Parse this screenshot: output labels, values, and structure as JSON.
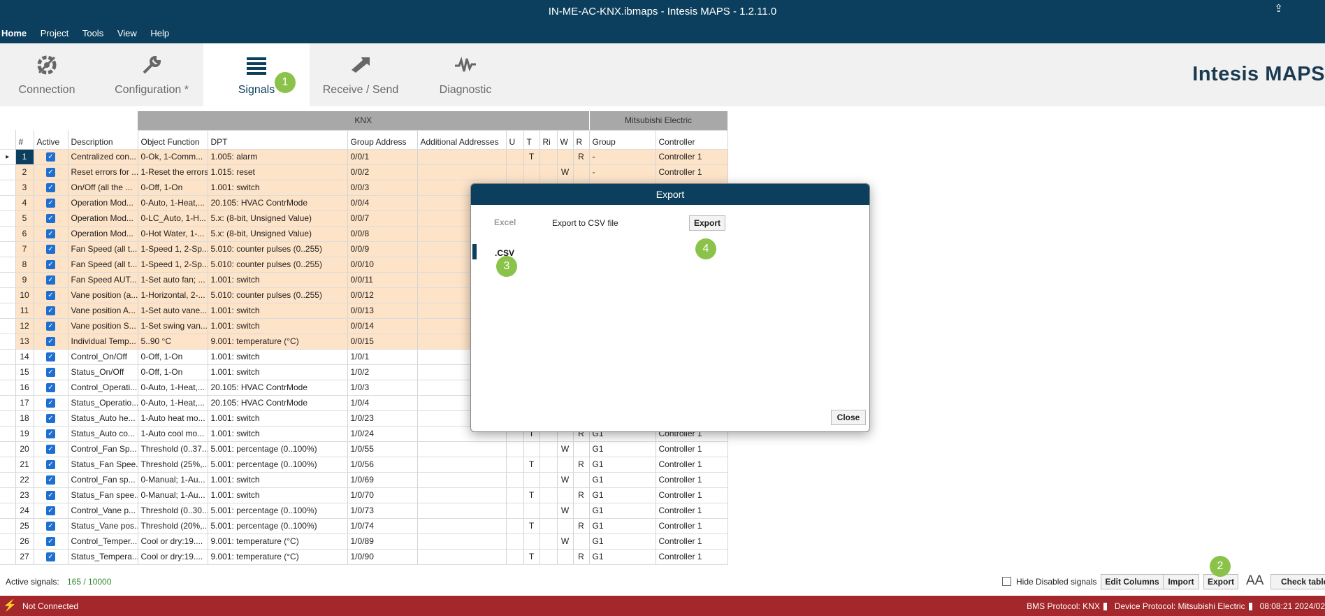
{
  "window": {
    "title": "IN-ME-AC-KNX.ibmaps - Intesis MAPS - 1.2.11.0"
  },
  "menu": {
    "items": [
      "Home",
      "Project",
      "Tools",
      "View",
      "Help"
    ]
  },
  "ribbon": {
    "tabs": [
      {
        "label": "Connection",
        "icon": "connection-gear-icon"
      },
      {
        "label": "Configuration *",
        "icon": "wrench-icon"
      },
      {
        "label": "Signals",
        "icon": "list-icon"
      },
      {
        "label": "Receive / Send",
        "icon": "send-arrows-icon"
      },
      {
        "label": "Diagnostic",
        "icon": "waveform-icon"
      }
    ],
    "active_tab": "Signals",
    "brand": "Intesis MAPS"
  },
  "badges": [
    "1",
    "2",
    "3",
    "4"
  ],
  "table": {
    "groups": {
      "knx": "KNX",
      "vendor": "Mitsubishi Electric"
    },
    "columns": [
      "#",
      "Active",
      "Description",
      "Object Function",
      "DPT",
      "Group Address",
      "Additional Addresses",
      "U",
      "T",
      "Ri",
      "W",
      "R",
      "Group",
      "Controller"
    ],
    "rows": [
      {
        "n": "1",
        "desc": "Centralized con...",
        "obj": "0-Ok, 1-Comm...",
        "dpt": "1.005: alarm",
        "ga": "0/0/1",
        "t": "T",
        "w": "",
        "r": "R",
        "grp": "-",
        "ctrl": "Controller 1"
      },
      {
        "n": "2",
        "desc": "Reset errors for ...",
        "obj": "1-Reset the errors",
        "dpt": "1.015: reset",
        "ga": "0/0/2",
        "t": "",
        "w": "W",
        "r": "",
        "grp": "-",
        "ctrl": "Controller 1"
      },
      {
        "n": "3",
        "desc": "On/Off (all the ...",
        "obj": "0-Off, 1-On",
        "dpt": "1.001: switch",
        "ga": "0/0/3",
        "t": "",
        "w": "",
        "r": "",
        "grp": "",
        "ctrl": ""
      },
      {
        "n": "4",
        "desc": "Operation Mod...",
        "obj": "0-Auto, 1-Heat,...",
        "dpt": "20.105: HVAC ContrMode",
        "ga": "0/0/4",
        "t": "",
        "w": "",
        "r": "",
        "grp": "",
        "ctrl": ""
      },
      {
        "n": "5",
        "desc": "Operation Mod...",
        "obj": "0-LC_Auto, 1-H...",
        "dpt": "5.x: (8-bit, Unsigned Value)",
        "ga": "0/0/7",
        "t": "",
        "w": "",
        "r": "",
        "grp": "",
        "ctrl": ""
      },
      {
        "n": "6",
        "desc": "Operation Mod...",
        "obj": "0-Hot Water, 1-...",
        "dpt": "5.x: (8-bit, Unsigned Value)",
        "ga": "0/0/8",
        "t": "",
        "w": "",
        "r": "",
        "grp": "",
        "ctrl": ""
      },
      {
        "n": "7",
        "desc": "Fan Speed (all t...",
        "obj": "1-Speed 1, 2-Sp...",
        "dpt": "5.010: counter pulses (0..255)",
        "ga": "0/0/9",
        "t": "",
        "w": "",
        "r": "",
        "grp": "",
        "ctrl": ""
      },
      {
        "n": "8",
        "desc": "Fan Speed (all t...",
        "obj": "1-Speed 1, 2-Sp...",
        "dpt": "5.010: counter pulses (0..255)",
        "ga": "0/0/10",
        "t": "",
        "w": "",
        "r": "",
        "grp": "",
        "ctrl": ""
      },
      {
        "n": "9",
        "desc": "Fan Speed AUT...",
        "obj": "1-Set auto fan; ...",
        "dpt": "1.001: switch",
        "ga": "0/0/11",
        "t": "",
        "w": "",
        "r": "",
        "grp": "",
        "ctrl": ""
      },
      {
        "n": "10",
        "desc": "Vane position (a...",
        "obj": "1-Horizontal, 2-...",
        "dpt": "5.010: counter pulses (0..255)",
        "ga": "0/0/12",
        "t": "",
        "w": "",
        "r": "",
        "grp": "",
        "ctrl": ""
      },
      {
        "n": "11",
        "desc": "Vane position A...",
        "obj": "1-Set auto vane...",
        "dpt": "1.001: switch",
        "ga": "0/0/13",
        "t": "",
        "w": "",
        "r": "",
        "grp": "",
        "ctrl": ""
      },
      {
        "n": "12",
        "desc": "Vane position S...",
        "obj": "1-Set swing van...",
        "dpt": "1.001: switch",
        "ga": "0/0/14",
        "t": "",
        "w": "",
        "r": "",
        "grp": "",
        "ctrl": ""
      },
      {
        "n": "13",
        "desc": "Individual Temp...",
        "obj": "5..90 °C",
        "dpt": "9.001: temperature (°C)",
        "ga": "0/0/15",
        "t": "",
        "w": "",
        "r": "",
        "grp": "",
        "ctrl": ""
      },
      {
        "n": "14",
        "desc": "Control_On/Off",
        "obj": "0-Off, 1-On",
        "dpt": "1.001: switch",
        "ga": "1/0/1",
        "t": "",
        "w": "",
        "r": "",
        "grp": "",
        "ctrl": ""
      },
      {
        "n": "15",
        "desc": "Status_On/Off",
        "obj": "0-Off, 1-On",
        "dpt": "1.001: switch",
        "ga": "1/0/2",
        "t": "",
        "w": "",
        "r": "",
        "grp": "",
        "ctrl": ""
      },
      {
        "n": "16",
        "desc": "Control_Operati...",
        "obj": "0-Auto, 1-Heat,...",
        "dpt": "20.105: HVAC ContrMode",
        "ga": "1/0/3",
        "t": "",
        "w": "",
        "r": "",
        "grp": "",
        "ctrl": ""
      },
      {
        "n": "17",
        "desc": "Status_Operatio...",
        "obj": "0-Auto, 1-Heat,...",
        "dpt": "20.105: HVAC ContrMode",
        "ga": "1/0/4",
        "t": "",
        "w": "",
        "r": "",
        "grp": "",
        "ctrl": ""
      },
      {
        "n": "18",
        "desc": "Status_Auto he...",
        "obj": "1-Auto heat mo...",
        "dpt": "1.001: switch",
        "ga": "1/0/23",
        "t": "",
        "w": "",
        "r": "",
        "grp": "",
        "ctrl": ""
      },
      {
        "n": "19",
        "desc": "Status_Auto co...",
        "obj": "1-Auto cool mo...",
        "dpt": "1.001: switch",
        "ga": "1/0/24",
        "t": "T",
        "w": "",
        "r": "R",
        "grp": "G1",
        "ctrl": "Controller 1"
      },
      {
        "n": "20",
        "desc": "Control_Fan Sp...",
        "obj": "Threshold (0..37...",
        "dpt": "5.001: percentage (0..100%)",
        "ga": "1/0/55",
        "t": "",
        "w": "W",
        "r": "",
        "grp": "G1",
        "ctrl": "Controller 1"
      },
      {
        "n": "21",
        "desc": "Status_Fan Spee...",
        "obj": "Threshold (25%,...",
        "dpt": "5.001: percentage (0..100%)",
        "ga": "1/0/56",
        "t": "T",
        "w": "",
        "r": "R",
        "grp": "G1",
        "ctrl": "Controller 1"
      },
      {
        "n": "22",
        "desc": "Control_Fan sp...",
        "obj": "0-Manual; 1-Au...",
        "dpt": "1.001: switch",
        "ga": "1/0/69",
        "t": "",
        "w": "W",
        "r": "",
        "grp": "G1",
        "ctrl": "Controller 1"
      },
      {
        "n": "23",
        "desc": "Status_Fan spee...",
        "obj": "0-Manual; 1-Au...",
        "dpt": "1.001: switch",
        "ga": "1/0/70",
        "t": "T",
        "w": "",
        "r": "R",
        "grp": "G1",
        "ctrl": "Controller 1"
      },
      {
        "n": "24",
        "desc": "Control_Vane p...",
        "obj": "Threshold (0..30...",
        "dpt": "5.001: percentage (0..100%)",
        "ga": "1/0/73",
        "t": "",
        "w": "W",
        "r": "",
        "grp": "G1",
        "ctrl": "Controller 1"
      },
      {
        "n": "25",
        "desc": "Status_Vane pos...",
        "obj": "Threshold (20%,...",
        "dpt": "5.001: percentage (0..100%)",
        "ga": "1/0/74",
        "t": "T",
        "w": "",
        "r": "R",
        "grp": "G1",
        "ctrl": "Controller 1"
      },
      {
        "n": "26",
        "desc": "Control_Temper...",
        "obj": "Cool or dry:19....",
        "dpt": "9.001: temperature (°C)",
        "ga": "1/0/89",
        "t": "",
        "w": "W",
        "r": "",
        "grp": "G1",
        "ctrl": "Controller 1"
      },
      {
        "n": "27",
        "desc": "Status_Tempera...",
        "obj": "Cool or dry:19....",
        "dpt": "9.001: temperature (°C)",
        "ga": "1/0/90",
        "t": "T",
        "w": "",
        "r": "R",
        "grp": "G1",
        "ctrl": "Controller 1"
      }
    ]
  },
  "statusbar": {
    "active_label": "Active signals:",
    "active_value": "165 / 10000",
    "hide_disabled": "Hide Disabled signals",
    "edit_columns": "Edit Columns",
    "import": "Import",
    "export": "Export",
    "font_size": "AA",
    "check_table": "Check table"
  },
  "footer": {
    "connection": "Not Connected",
    "bms": "BMS Protocol: KNX",
    "device": "Device Protocol: Mitsubishi Electric",
    "time": "08:08:21 2024/02"
  },
  "dialog": {
    "title": "Export",
    "excel": "Excel",
    "csv": ".CSV",
    "csv_title": "Export to CSV file",
    "export_button": "Export",
    "close_button": "Close"
  },
  "colors": {
    "header_bg": "#0c3f5d",
    "highlight_row": "#fde3c8",
    "footer_bg": "#a3272b",
    "badge": "#8bc34a",
    "checkbox": "#1f6fd1"
  }
}
